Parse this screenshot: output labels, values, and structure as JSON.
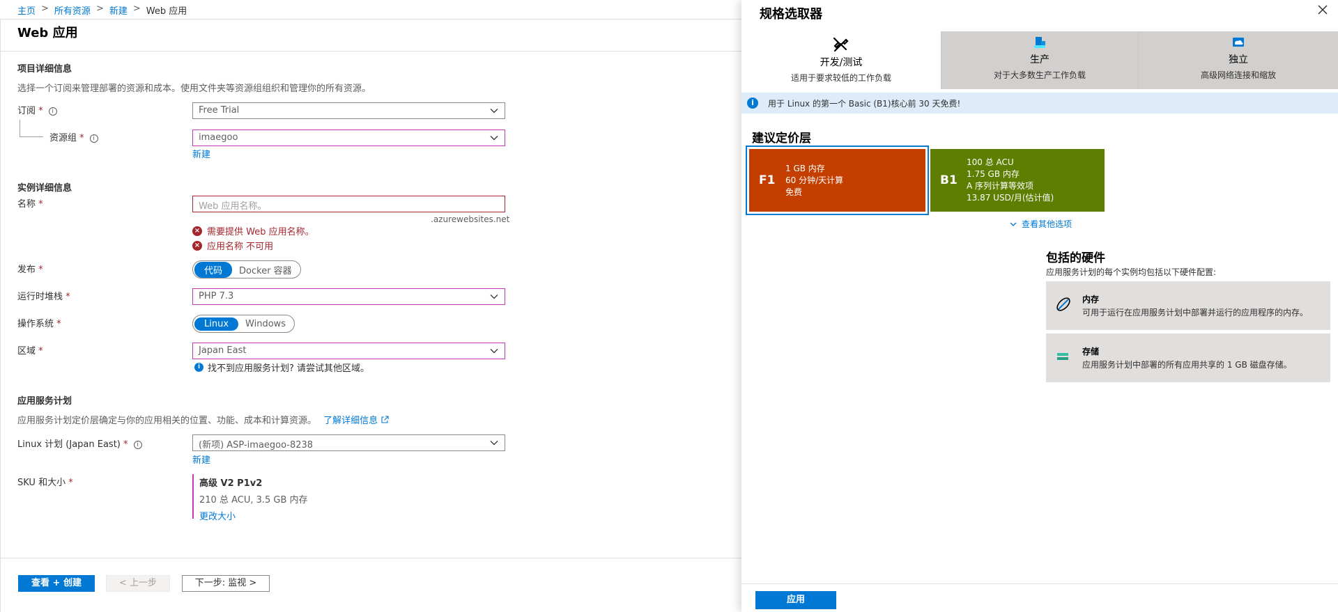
{
  "breadcrumb": [
    "主页",
    "所有资源",
    "新建",
    "Web 应用"
  ],
  "page_title": "Web 应用",
  "project": {
    "title": "项目详细信息",
    "desc": "选择一个订阅来管理部署的资源和成本。使用文件夹等资源组组织和管理你的所有资源。",
    "subscription_label": "订阅",
    "subscription_value": "Free Trial",
    "rg_label": "资源组",
    "rg_value": "imaegoo",
    "new_link": "新建"
  },
  "instance": {
    "title": "实例详细信息",
    "name_label": "名称",
    "name_placeholder": "Web 应用名称。",
    "domain_suffix": ".azurewebsites.net",
    "error1": "需要提供 Web 应用名称。",
    "error2": "应用名称 不可用",
    "publish_label": "发布",
    "publish_options": [
      "代码",
      "Docker 容器"
    ],
    "stack_label": "运行时堆栈",
    "stack_value": "PHP 7.3",
    "os_label": "操作系统",
    "os_options": [
      "Linux",
      "Windows"
    ],
    "region_label": "区域",
    "region_value": "Japan East",
    "region_hint": "找不到应用服务计划? 请尝试其他区域。"
  },
  "plan": {
    "title": "应用服务计划",
    "desc": "应用服务计划定价层确定与你的应用相关的位置、功能、成本和计算资源。",
    "learn_more": "了解详细信息",
    "linux_plan_label": "Linux 计划 (Japan East)",
    "linux_plan_value": "(新项) ASP-imaegoo-8238",
    "new_link": "新建",
    "sku_label": "SKU 和大小",
    "sku_name": "高级 V2 P1v2",
    "sku_desc": "210 总 ACU, 3.5 GB 内存",
    "sku_change": "更改大小"
  },
  "footer": {
    "review_create": "查看 + 创建",
    "prev": "< 上一步",
    "next": "下一步: 监视 >"
  },
  "panel": {
    "title": "规格选取器",
    "tabs": [
      {
        "name": "开发/测试",
        "sub": "适用于要求较低的工作负载",
        "icon": "tools-icon",
        "selected": true
      },
      {
        "name": "生产",
        "sub": "对于大多数生产工作负载",
        "icon": "production-icon",
        "selected": false
      },
      {
        "name": "独立",
        "sub": "高级网络连接和缩放",
        "icon": "isolated-icon",
        "selected": false
      }
    ],
    "info": "用于 Linux 的第一个 Basic (B1)核心前 30 天免费!",
    "tier_title": "建议定价层",
    "tiers": [
      {
        "code": "F1",
        "lines": [
          "1 GB 内存",
          "60 分钟/天计算",
          "免费"
        ],
        "color": "#c43e00",
        "selected": true
      },
      {
        "code": "B1",
        "lines": [
          "100 总 ACU",
          "1.75 GB 内存",
          "A 序列计算等效项",
          "13.87 USD/月(估计值)"
        ],
        "color": "#5d7e00",
        "selected": false
      }
    ],
    "see_more": "查看其他选项",
    "hw_title": "包括的硬件",
    "hw_desc": "应用服务计划的每个实例均包括以下硬件配置:",
    "hw_items": [
      {
        "title": "内存",
        "desc": "可用于运行在应用服务计划中部署并运行的应用程序的内存。",
        "icon": "memory-icon"
      },
      {
        "title": "存储",
        "desc": "应用服务计划中部署的所有应用共享的 1 GB 磁盘存储。",
        "icon": "storage-icon"
      }
    ],
    "apply": "应用"
  }
}
